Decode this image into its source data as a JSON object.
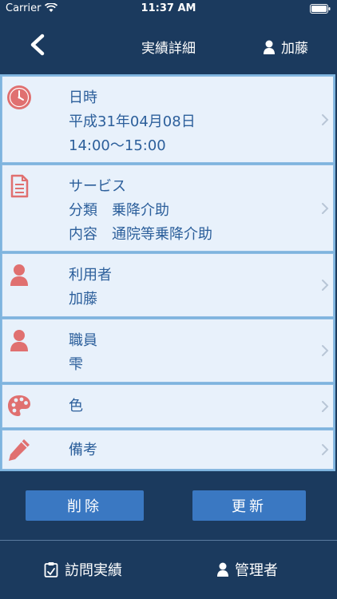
{
  "status_bar": {
    "carrier": "Carrier",
    "time": "11:37 AM",
    "icons": [
      "wifi-icon",
      "battery-icon"
    ]
  },
  "nav": {
    "back_icon": "chevron-left-icon",
    "title": "実績詳細",
    "user_icon": "person-icon",
    "user_name": "加藤"
  },
  "rows": [
    {
      "icon": "clock-icon",
      "lines": [
        "日時",
        "平成31年04月08日",
        "14:00～15:00"
      ]
    },
    {
      "icon": "document-icon",
      "lines": [
        "サービス",
        "分類　乗降介助",
        "内容　通院等乗降介助"
      ]
    },
    {
      "icon": "person-icon",
      "lines": [
        "利用者",
        "加藤"
      ]
    },
    {
      "icon": "person-icon",
      "lines": [
        "職員",
        "雫"
      ]
    },
    {
      "icon": "palette-icon",
      "lines": [
        "色"
      ]
    },
    {
      "icon": "pencil-icon",
      "lines": [
        "備考"
      ]
    }
  ],
  "actions": {
    "delete_label": "削除",
    "update_label": "更新"
  },
  "tabs": [
    {
      "icon": "clipboard-icon",
      "label": "訪問実績"
    },
    {
      "icon": "person-icon",
      "label": "管理者"
    }
  ],
  "colors": {
    "background": "#1b3a5e",
    "row_background": "#e8f1fb",
    "row_text": "#2c5f9b",
    "icon_red": "#e07070",
    "button": "#3a78c2"
  }
}
